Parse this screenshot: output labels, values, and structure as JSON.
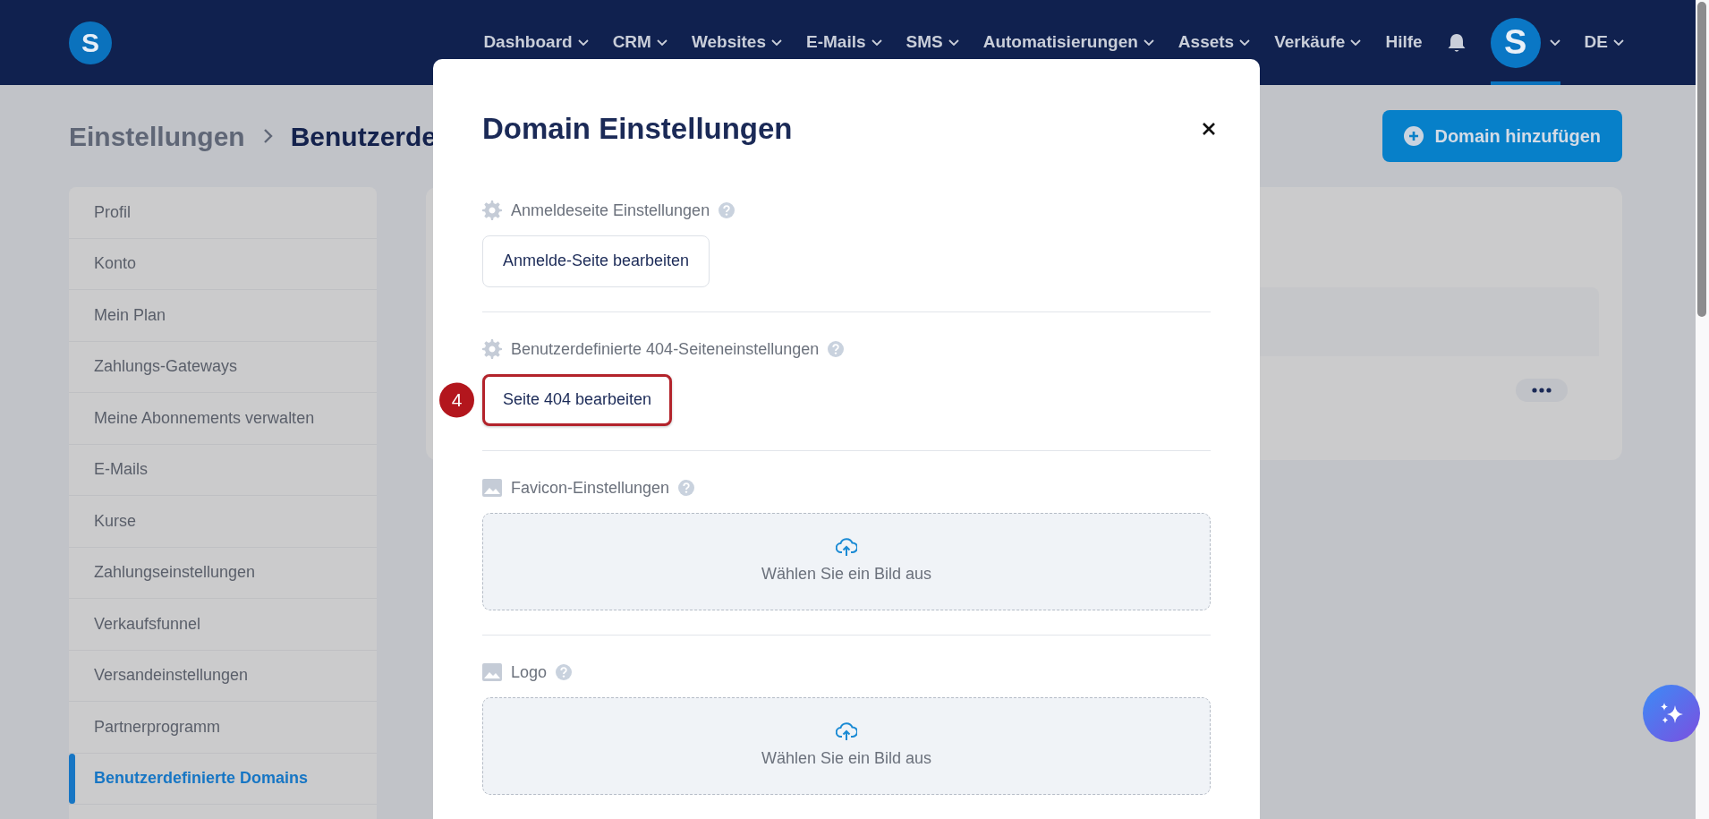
{
  "navbar": {
    "logo": "S",
    "items": [
      {
        "label": "Dashboard",
        "dropdown": true
      },
      {
        "label": "CRM",
        "dropdown": true
      },
      {
        "label": "Websites",
        "dropdown": true
      },
      {
        "label": "E-Mails",
        "dropdown": true
      },
      {
        "label": "SMS",
        "dropdown": true
      },
      {
        "label": "Automatisierungen",
        "dropdown": true
      },
      {
        "label": "Assets",
        "dropdown": true
      },
      {
        "label": "Verkäufe",
        "dropdown": true
      },
      {
        "label": "Hilfe",
        "dropdown": false
      }
    ],
    "avatar": "S",
    "language": "DE"
  },
  "breadcrumb": [
    "Einstellungen",
    "Benutzerde"
  ],
  "add_button": "Domain hinzufügen",
  "sidebar": {
    "items": [
      {
        "label": "Profil",
        "selected": false
      },
      {
        "label": "Konto",
        "selected": false
      },
      {
        "label": "Mein Plan",
        "selected": false
      },
      {
        "label": "Zahlungs-Gateways",
        "selected": false
      },
      {
        "label": "Meine Abonnements verwalten",
        "selected": false
      },
      {
        "label": "E-Mails",
        "selected": false
      },
      {
        "label": "Kurse",
        "selected": false
      },
      {
        "label": "Zahlungseinstellungen",
        "selected": false
      },
      {
        "label": "Verkaufsfunnel",
        "selected": false
      },
      {
        "label": "Versandeinstellungen",
        "selected": false
      },
      {
        "label": "Partnerprogramm",
        "selected": false
      },
      {
        "label": "Benutzerdefinierte Domains",
        "selected": true
      }
    ]
  },
  "modal": {
    "title": "Domain Einstellungen",
    "sections": [
      {
        "kind": "button",
        "label": "Anmeldeseite Einstellungen",
        "button": "Anmelde-Seite bearbeiten",
        "highlighted": false
      },
      {
        "kind": "button",
        "label": "Benutzerdefinierte 404-Seiteneinstellungen",
        "button": "Seite 404 bearbeiten",
        "highlighted": true,
        "step": "4"
      },
      {
        "kind": "upload",
        "label": "Favicon-Einstellungen",
        "prompt": "Wählen Sie ein Bild aus"
      },
      {
        "kind": "upload",
        "label": "Logo",
        "prompt": "Wählen Sie ein Bild aus"
      }
    ]
  }
}
